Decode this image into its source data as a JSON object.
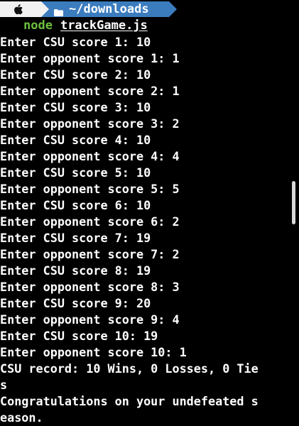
{
  "prompt": {
    "apple_icon": "apple-logo-icon",
    "folder_icon": "folder-icon",
    "directory": "~/downloads",
    "colors": {
      "apple_segment": "#f2f2f2",
      "dir_segment": "#3b7cbf",
      "command": "#6fbf3f"
    }
  },
  "command": {
    "name": "node",
    "argument": "trackGame.js"
  },
  "output": [
    "Enter CSU score 1: 10",
    "Enter opponent score 1: 1",
    "Enter CSU score 2: 10",
    "Enter opponent score 2: 1",
    "Enter CSU score 3: 10",
    "Enter opponent score 3: 2",
    "Enter CSU score 4: 10",
    "Enter opponent score 4: 4",
    "Enter CSU score 5: 10",
    "Enter opponent score 5: 5",
    "Enter CSU score 6: 10",
    "Enter opponent score 6: 2",
    "Enter CSU score 7: 19",
    "Enter opponent score 7: 2",
    "Enter CSU score 8: 19",
    "Enter opponent score 8: 3",
    "Enter CSU score 9: 20",
    "Enter opponent score 9: 4",
    "Enter CSU score 10: 19",
    "Enter opponent score 10: 1",
    "CSU record: 10 Wins, 0 Losses, 0 Tie",
    "s",
    "Congratulations on your undefeated s",
    "eason."
  ]
}
